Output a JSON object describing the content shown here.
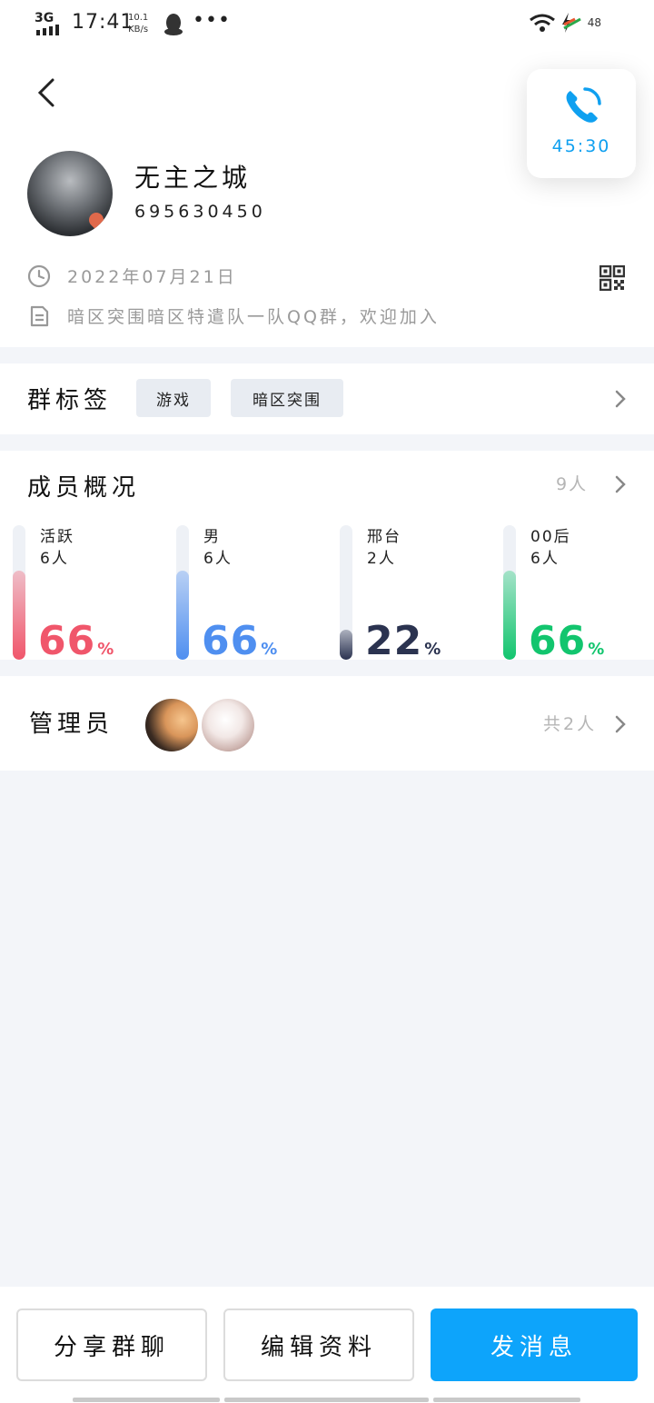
{
  "status_bar": {
    "network": "3G",
    "time": "17:41",
    "speed_value": "10.1",
    "speed_unit": "KB/s",
    "more": "•••",
    "battery": "48"
  },
  "floating_call": {
    "duration": "45:30",
    "color": "#0fa0f0"
  },
  "group": {
    "name": "无主之城",
    "id": "695630450",
    "created_date": "2022年07月21日",
    "description": "暗区突围暗区特遣队一队QQ群，欢迎加入"
  },
  "tags_section": {
    "title": "群标签",
    "tags": [
      "游戏",
      "暗区突围"
    ]
  },
  "members_section": {
    "title": "成员概况",
    "count": "9人",
    "stats": [
      {
        "label": "活跃",
        "count": "6人",
        "percent": "66",
        "unit": "%",
        "fill_fraction": 0.66,
        "color": "#f0566b"
      },
      {
        "label": "男",
        "count": "6人",
        "percent": "66",
        "unit": "%",
        "fill_fraction": 0.66,
        "color": "#4f8ff0"
      },
      {
        "label": "邢台",
        "count": "2人",
        "percent": "22",
        "unit": "%",
        "fill_fraction": 0.22,
        "color": "#2b3350"
      },
      {
        "label": "00后",
        "count": "6人",
        "percent": "66",
        "unit": "%",
        "fill_fraction": 0.66,
        "color": "#12c56e"
      }
    ]
  },
  "admins_section": {
    "title": "管理员",
    "count": "共2人"
  },
  "actions": {
    "share": "分享群聊",
    "edit": "编辑资料",
    "message": "发消息",
    "primary_color": "#0da4fb"
  }
}
